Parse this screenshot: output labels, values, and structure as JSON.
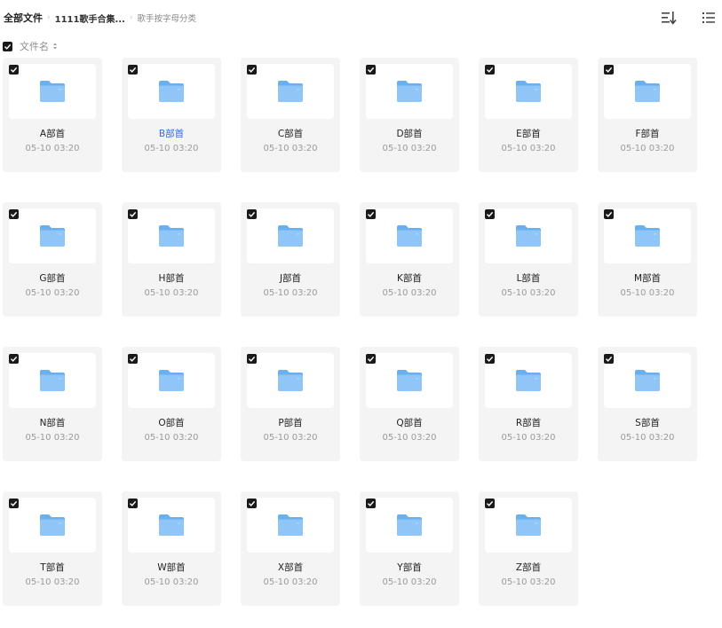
{
  "breadcrumb": {
    "root": "全部文件",
    "parent": "1111歌手合集...",
    "current": "歌手按字母分类"
  },
  "toolbar": {
    "sort_icon": "sort-icon",
    "view_icon": "list-view-icon"
  },
  "header": {
    "column_label": "文件名"
  },
  "colors": {
    "accent": "#2b6be6",
    "folder": "#7fbcf5",
    "card_bg": "#f4f4f5"
  },
  "folders": [
    {
      "name": "A部首",
      "date": "05-10 03:20",
      "checked": true,
      "highlight": false
    },
    {
      "name": "B部首",
      "date": "05-10 03:20",
      "checked": true,
      "highlight": true
    },
    {
      "name": "C部首",
      "date": "05-10 03:20",
      "checked": true,
      "highlight": false
    },
    {
      "name": "D部首",
      "date": "05-10 03:20",
      "checked": true,
      "highlight": false
    },
    {
      "name": "E部首",
      "date": "05-10 03:20",
      "checked": true,
      "highlight": false
    },
    {
      "name": "F部首",
      "date": "05-10 03:20",
      "checked": true,
      "highlight": false
    },
    {
      "name": "G部首",
      "date": "05-10 03:20",
      "checked": true,
      "highlight": false
    },
    {
      "name": "H部首",
      "date": "05-10 03:20",
      "checked": true,
      "highlight": false
    },
    {
      "name": "J部首",
      "date": "05-10 03:20",
      "checked": true,
      "highlight": false
    },
    {
      "name": "K部首",
      "date": "05-10 03:20",
      "checked": true,
      "highlight": false
    },
    {
      "name": "L部首",
      "date": "05-10 03:20",
      "checked": true,
      "highlight": false
    },
    {
      "name": "M部首",
      "date": "05-10 03:20",
      "checked": true,
      "highlight": false
    },
    {
      "name": "N部首",
      "date": "05-10 03:20",
      "checked": true,
      "highlight": false
    },
    {
      "name": "O部首",
      "date": "05-10 03:20",
      "checked": true,
      "highlight": false
    },
    {
      "name": "P部首",
      "date": "05-10 03:20",
      "checked": true,
      "highlight": false
    },
    {
      "name": "Q部首",
      "date": "05-10 03:20",
      "checked": true,
      "highlight": false
    },
    {
      "name": "R部首",
      "date": "05-10 03:20",
      "checked": true,
      "highlight": false
    },
    {
      "name": "S部首",
      "date": "05-10 03:20",
      "checked": true,
      "highlight": false
    },
    {
      "name": "T部首",
      "date": "05-10 03:20",
      "checked": true,
      "highlight": false
    },
    {
      "name": "W部首",
      "date": "05-10 03:20",
      "checked": true,
      "highlight": false
    },
    {
      "name": "X部首",
      "date": "05-10 03:20",
      "checked": true,
      "highlight": false
    },
    {
      "name": "Y部首",
      "date": "05-10 03:20",
      "checked": true,
      "highlight": false
    },
    {
      "name": "Z部首",
      "date": "05-10 03:20",
      "checked": true,
      "highlight": false
    }
  ]
}
